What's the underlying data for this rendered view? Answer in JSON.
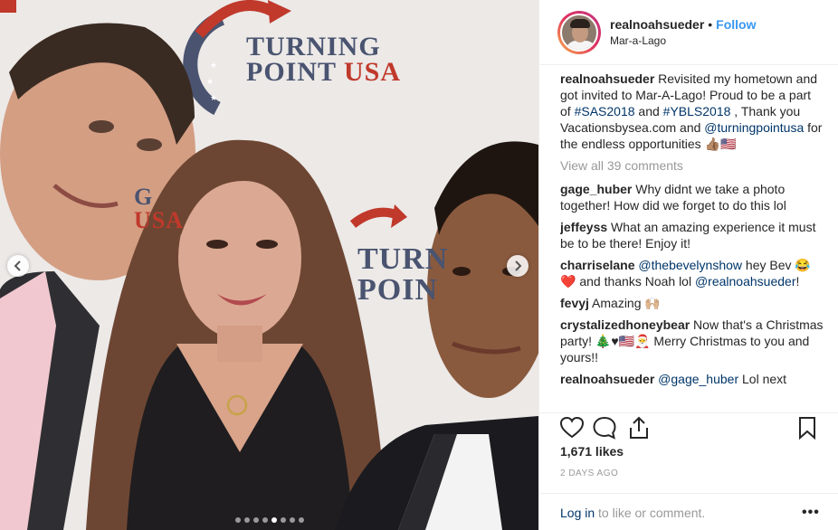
{
  "photo": {
    "brand_top_line1": "TURNING",
    "brand_top_line2": "POINT",
    "brand_top_line3": "USA",
    "brand_mid_fragment1": "G",
    "brand_mid_fragment2": "USA",
    "brand_right_line1": "TURN",
    "brand_right_line2": "POIN",
    "carousel": {
      "total": 8,
      "active": 4
    }
  },
  "header": {
    "username": "realnoahsueder",
    "separator": "•",
    "follow_label": "Follow",
    "location": "Mar-a-Lago"
  },
  "caption": {
    "username": "realnoahsueder",
    "text_1": " Revisited my hometown and got invited to Mar-A-Lago! Proud to be a part of ",
    "hashtag_1": "#SAS2018",
    "text_2": " and ",
    "hashtag_2": "#YBLS2018",
    "text_3": " , Thank you Vacationsbysea.com and ",
    "mention_1": "@turningpointusa",
    "text_4": " for the endless opportunities 👍🏽🇺🇸"
  },
  "view_all_label": "View all 39 comments",
  "comments": [
    {
      "username": "gage_huber",
      "parts": [
        {
          "t": " Why didnt we take a photo together! How did we forget to do this lol"
        }
      ]
    },
    {
      "username": "jeffeyss",
      "parts": [
        {
          "t": " What an amazing experience it must be to be there! Enjoy it!"
        }
      ]
    },
    {
      "username": "charriselane",
      "parts": [
        {
          "t": " "
        },
        {
          "t": "@thebevelynshow",
          "tag": true
        },
        {
          "t": " hey Bev 😂❤️ and thanks Noah lol "
        },
        {
          "t": "@realnoahsueder",
          "tag": true
        },
        {
          "t": "!"
        }
      ]
    },
    {
      "username": "fevyj",
      "parts": [
        {
          "t": " Amazing 🙌🏼"
        }
      ]
    },
    {
      "username": "crystalizedhoneybear",
      "parts": [
        {
          "t": " Now that's a Christmas party! 🎄♥🇺🇸🎅 Merry Christmas to you and yours!!"
        }
      ]
    },
    {
      "username": "realnoahsueder",
      "parts": [
        {
          "t": " "
        },
        {
          "t": "@gage_huber",
          "tag": true
        },
        {
          "t": " Lol next"
        }
      ]
    }
  ],
  "likes_label": "1,671 likes",
  "date_label": "2 DAYS AGO",
  "footer": {
    "login_link": "Log in",
    "login_rest": " to like or comment.",
    "more_label": "•••"
  },
  "icons": {
    "like": "heart-icon",
    "comment": "comment-bubble-icon",
    "share": "share-icon",
    "save": "bookmark-icon",
    "prev": "chevron-left-icon",
    "next": "chevron-right-icon"
  },
  "colors": {
    "link_blue": "#3897f0",
    "tag_blue": "#003569",
    "brand_red": "#c0392b",
    "brand_navy": "#4a5470",
    "muted": "#999999"
  }
}
